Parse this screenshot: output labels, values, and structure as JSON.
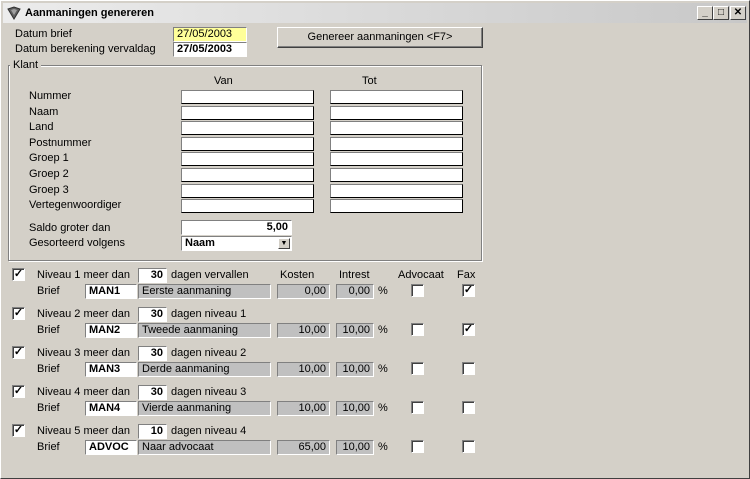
{
  "window": {
    "title": "Aanmaningen genereren"
  },
  "header": {
    "datum_brief_label": "Datum brief",
    "datum_brief_value": "27/05/2003",
    "datum_vervaldag_label": "Datum berekening vervaldag",
    "datum_vervaldag_value": "27/05/2003",
    "generate_button": "Genereer aanmaningen <F7>"
  },
  "klant": {
    "group_label": "Klant",
    "van_header": "Van",
    "tot_header": "Tot",
    "fields": [
      "Nummer",
      "Naam",
      "Land",
      "Postnummer",
      "Groep 1",
      "Groep 2",
      "Groep 3",
      "Vertegenwoordiger"
    ],
    "saldo_label": "Saldo groter dan",
    "saldo_value": "5,00",
    "sort_label": "Gesorteerd volgens",
    "sort_value": "Naam"
  },
  "levels_header": {
    "kosten": "Kosten",
    "intrest": "Intrest",
    "advocaat": "Advocaat",
    "fax": "Fax"
  },
  "levels": [
    {
      "checked": true,
      "label": "Niveau 1 meer dan",
      "days": "30",
      "suffix": "dagen vervallen",
      "brief_label": "Brief",
      "code": "MAN1",
      "desc": "Eerste aanmaning",
      "kosten": "0,00",
      "intrest": "0,00",
      "pct": "%",
      "advocaat": false,
      "fax": true
    },
    {
      "checked": true,
      "label": "Niveau 2 meer dan",
      "days": "30",
      "suffix": "dagen niveau 1",
      "brief_label": "Brief",
      "code": "MAN2",
      "desc": "Tweede aanmaning",
      "kosten": "10,00",
      "intrest": "10,00",
      "pct": "%",
      "advocaat": false,
      "fax": true
    },
    {
      "checked": true,
      "label": "Niveau 3 meer dan",
      "days": "30",
      "suffix": "dagen niveau 2",
      "brief_label": "Brief",
      "code": "MAN3",
      "desc": "Derde aanmaning",
      "kosten": "10,00",
      "intrest": "10,00",
      "pct": "%",
      "advocaat": false,
      "fax": false
    },
    {
      "checked": true,
      "label": "Niveau 4 meer dan",
      "days": "30",
      "suffix": "dagen niveau 3",
      "brief_label": "Brief",
      "code": "MAN4",
      "desc": "Vierde aanmaning",
      "kosten": "10,00",
      "intrest": "10,00",
      "pct": "%",
      "advocaat": false,
      "fax": false
    },
    {
      "checked": true,
      "label": "Niveau 5 meer dan",
      "days": "10",
      "suffix": "dagen niveau 4",
      "brief_label": "Brief",
      "code": "ADVOC",
      "desc": "Naar advocaat",
      "kosten": "65,00",
      "intrest": "10,00",
      "pct": "%",
      "advocaat": false,
      "fax": false
    }
  ],
  "colors": {
    "window_bg": "#d4d0c8",
    "date_highlight": "#ffff99"
  }
}
